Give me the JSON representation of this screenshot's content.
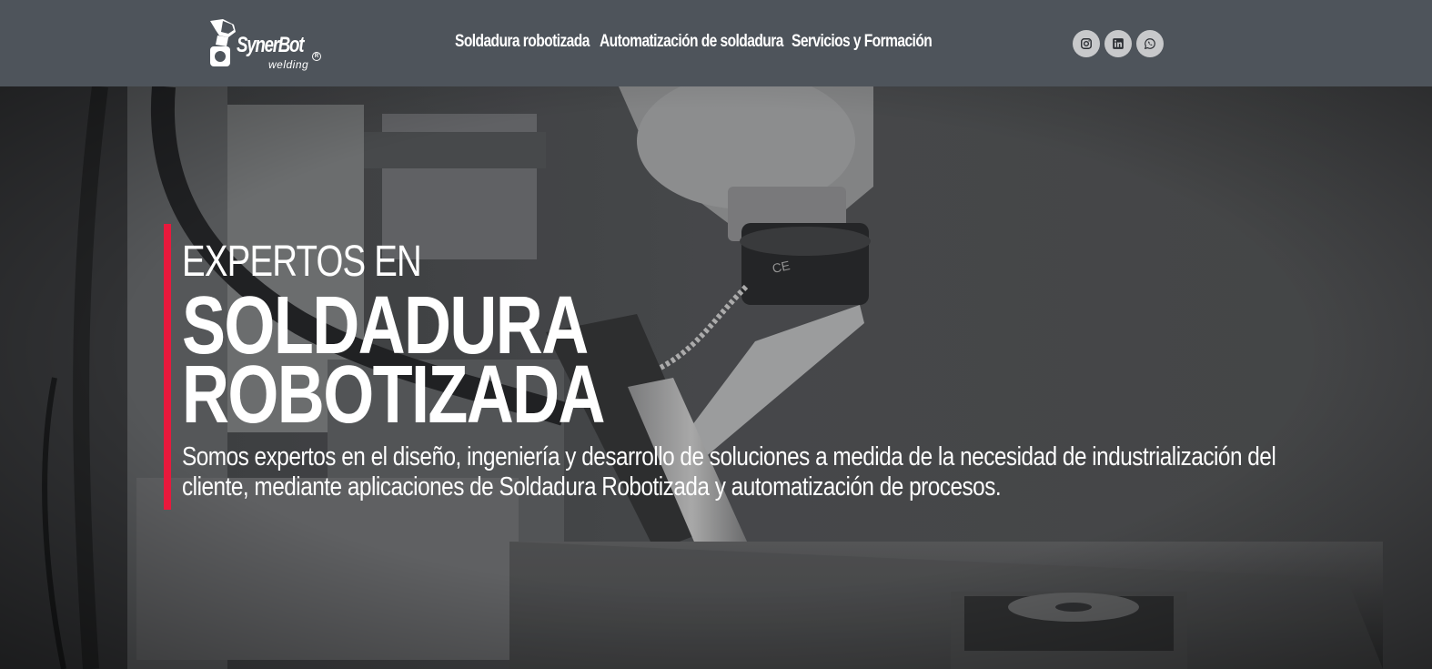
{
  "brand": {
    "name": "SynerBot",
    "registered": "R",
    "tagline": "welding"
  },
  "nav": {
    "items": [
      {
        "label": "Soldadura robotizada"
      },
      {
        "label": "Automatización de soldadura"
      },
      {
        "label": "Servicios y Formación"
      }
    ]
  },
  "social": [
    {
      "icon": "instagram-icon"
    },
    {
      "icon": "linkedin-icon"
    },
    {
      "icon": "whatsapp-icon"
    }
  ],
  "hero": {
    "kicker": "EXPERTOS EN",
    "headline_line1": "SOLDADURA",
    "headline_line2": "ROBOTIZADA",
    "description_line1": "Somos expertos en el diseño, ingeniería y desarrollo de soluciones a medida de la necesidad de industrialización del",
    "description_line2": "cliente, mediante aplicaciones de Soldadura Robotizada y automatización de procesos.",
    "accent_color": "#e8193c"
  },
  "colors": {
    "header_bg": "#4e545b",
    "social_bg": "#c8c9cb",
    "text": "#ffffff"
  }
}
